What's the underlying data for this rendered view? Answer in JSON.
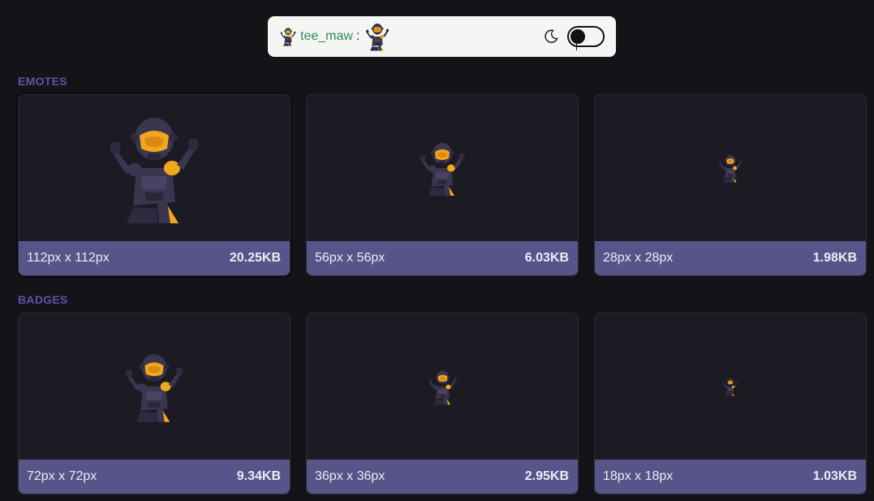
{
  "chat_preview": {
    "username": "tee_maw",
    "colon": ":",
    "username_color": "#2e8b57"
  },
  "theme_toggle": {
    "icon": "moon-icon",
    "state": "off"
  },
  "sections": {
    "emotes": {
      "title": "EMOTES",
      "cards": [
        {
          "dimensions": "112px x 112px",
          "filesize": "20.25KB"
        },
        {
          "dimensions": "56px x 56px",
          "filesize": "6.03KB"
        },
        {
          "dimensions": "28px x 28px",
          "filesize": "1.98KB"
        }
      ]
    },
    "badges": {
      "title": "BADGES",
      "cards": [
        {
          "dimensions": "72px x 72px",
          "filesize": "9.34KB"
        },
        {
          "dimensions": "36px x 36px",
          "filesize": "2.95KB"
        },
        {
          "dimensions": "18px x 18px",
          "filesize": "1.03KB"
        }
      ]
    }
  },
  "colors": {
    "background": "#141318",
    "card": "#1c1b24",
    "footer": "#57548a",
    "section_title": "#5b56a3",
    "armor_dark": "#3b3550",
    "armor_gold": "#f2a81c"
  }
}
